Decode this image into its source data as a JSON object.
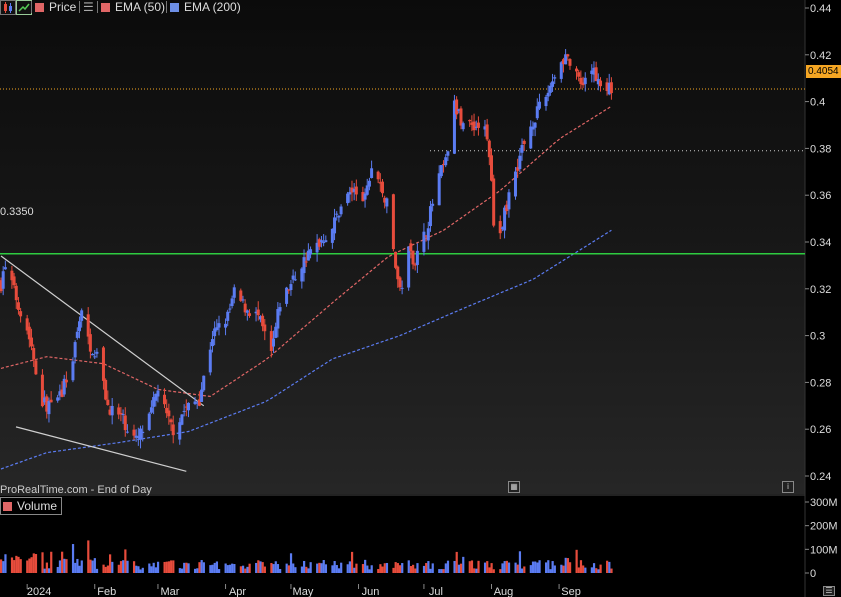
{
  "toolbar": {
    "items": [
      {
        "name": "Price",
        "color": "#e06666"
      },
      {
        "name": "EMA (50)",
        "color": "#e06666"
      },
      {
        "name": "EMA (200)",
        "color": "#6d8fe6"
      }
    ]
  },
  "watermark": "ProRealTime.com - End of Day",
  "volume_legend": "Volume",
  "price_tag": "0.4054",
  "support_label": "0.3350",
  "colors": {
    "up": "#5b7cf2",
    "down": "#e74c3c",
    "support": "#2ecc40",
    "ema50": "#e06666",
    "ema200": "#5b7cf2",
    "price_line": "#f5a623",
    "background": "#000000"
  },
  "chart_data": {
    "type": "candlestick",
    "price_axis": {
      "ticks": [
        "0.44",
        "0.42",
        "0.4",
        "0.38",
        "0.36",
        "0.34",
        "0.32",
        "0.3",
        "0.28",
        "0.26",
        "0.24"
      ],
      "range": [
        0.235,
        0.445
      ]
    },
    "volume_axis": {
      "ticks": [
        "300M",
        "200M",
        "100M",
        "0"
      ],
      "range": [
        0,
        300
      ]
    },
    "x_axis": {
      "labels": [
        "2024",
        "Feb",
        "Mar",
        "Apr",
        "May",
        "Jun",
        "Jul",
        "Aug",
        "Sep"
      ]
    },
    "last_price": 0.4054,
    "support_level": 0.335,
    "resistance_level": 0.379,
    "trendline_upper": [
      {
        "date": "2023-12-20",
        "value": 0.334
      },
      {
        "date": "2024-03-22",
        "value": 0.27
      }
    ],
    "trendline_lower": [
      {
        "date": "2023-12-20",
        "value": 0.261
      },
      {
        "date": "2024-03-14",
        "value": 0.242
      }
    ],
    "close_anchors": [
      {
        "date": "2023-12-20",
        "value": 0.322
      },
      {
        "date": "2023-12-22",
        "value": 0.33
      },
      {
        "date": "2024-01-02",
        "value": 0.3
      },
      {
        "date": "2024-01-08",
        "value": 0.272
      },
      {
        "date": "2024-01-12",
        "value": 0.269
      },
      {
        "date": "2024-01-17",
        "value": 0.276
      },
      {
        "date": "2024-01-22",
        "value": 0.29
      },
      {
        "date": "2024-01-24",
        "value": 0.3
      },
      {
        "date": "2024-01-26",
        "value": 0.312
      },
      {
        "date": "2024-01-30",
        "value": 0.296
      },
      {
        "date": "2024-02-02",
        "value": 0.292
      },
      {
        "date": "2024-02-07",
        "value": 0.27
      },
      {
        "date": "2024-02-13",
        "value": 0.265
      },
      {
        "date": "2024-02-20",
        "value": 0.255
      },
      {
        "date": "2024-02-26",
        "value": 0.264
      },
      {
        "date": "2024-03-01",
        "value": 0.278
      },
      {
        "date": "2024-03-05",
        "value": 0.265
      },
      {
        "date": "2024-03-08",
        "value": 0.26
      },
      {
        "date": "2024-03-13",
        "value": 0.268
      },
      {
        "date": "2024-03-20",
        "value": 0.273
      },
      {
        "date": "2024-03-26",
        "value": 0.3
      },
      {
        "date": "2024-04-02",
        "value": 0.308
      },
      {
        "date": "2024-04-05",
        "value": 0.318
      },
      {
        "date": "2024-04-10",
        "value": 0.312
      },
      {
        "date": "2024-04-16",
        "value": 0.308
      },
      {
        "date": "2024-04-22",
        "value": 0.292
      },
      {
        "date": "2024-04-26",
        "value": 0.314
      },
      {
        "date": "2024-05-01",
        "value": 0.322
      },
      {
        "date": "2024-05-07",
        "value": 0.332
      },
      {
        "date": "2024-05-14",
        "value": 0.34
      },
      {
        "date": "2024-05-20",
        "value": 0.346
      },
      {
        "date": "2024-05-24",
        "value": 0.356
      },
      {
        "date": "2024-05-29",
        "value": 0.362
      },
      {
        "date": "2024-06-04",
        "value": 0.358
      },
      {
        "date": "2024-06-07",
        "value": 0.372
      },
      {
        "date": "2024-06-11",
        "value": 0.364
      },
      {
        "date": "2024-06-14",
        "value": 0.356
      },
      {
        "date": "2024-06-18",
        "value": 0.33
      },
      {
        "date": "2024-06-20",
        "value": 0.318
      },
      {
        "date": "2024-06-24",
        "value": 0.336
      },
      {
        "date": "2024-06-27",
        "value": 0.332
      },
      {
        "date": "2024-07-02",
        "value": 0.345
      },
      {
        "date": "2024-07-08",
        "value": 0.368
      },
      {
        "date": "2024-07-11",
        "value": 0.374
      },
      {
        "date": "2024-07-15",
        "value": 0.398
      },
      {
        "date": "2024-07-18",
        "value": 0.392
      },
      {
        "date": "2024-07-24",
        "value": 0.39
      },
      {
        "date": "2024-07-29",
        "value": 0.388
      },
      {
        "date": "2024-07-31",
        "value": 0.378
      },
      {
        "date": "2024-08-02",
        "value": 0.35
      },
      {
        "date": "2024-08-05",
        "value": 0.344
      },
      {
        "date": "2024-08-09",
        "value": 0.36
      },
      {
        "date": "2024-08-15",
        "value": 0.38
      },
      {
        "date": "2024-08-20",
        "value": 0.392
      },
      {
        "date": "2024-08-26",
        "value": 0.402
      },
      {
        "date": "2024-08-30",
        "value": 0.412
      },
      {
        "date": "2024-09-04",
        "value": 0.42
      },
      {
        "date": "2024-09-09",
        "value": 0.41
      },
      {
        "date": "2024-09-12",
        "value": 0.405
      },
      {
        "date": "2024-09-16",
        "value": 0.414
      },
      {
        "date": "2024-09-20",
        "value": 0.408
      },
      {
        "date": "2024-09-25",
        "value": 0.4054
      }
    ],
    "ema50_anchors": [
      {
        "date": "2023-12-20",
        "value": 0.286
      },
      {
        "date": "2024-01-10",
        "value": 0.291
      },
      {
        "date": "2024-02-05",
        "value": 0.288
      },
      {
        "date": "2024-03-01",
        "value": 0.277
      },
      {
        "date": "2024-03-25",
        "value": 0.274
      },
      {
        "date": "2024-04-20",
        "value": 0.29
      },
      {
        "date": "2024-05-20",
        "value": 0.314
      },
      {
        "date": "2024-06-15",
        "value": 0.334
      },
      {
        "date": "2024-07-10",
        "value": 0.345
      },
      {
        "date": "2024-08-05",
        "value": 0.362
      },
      {
        "date": "2024-09-01",
        "value": 0.384
      },
      {
        "date": "2024-09-25",
        "value": 0.398
      }
    ],
    "ema200_anchors": [
      {
        "date": "2023-12-20",
        "value": 0.243
      },
      {
        "date": "2024-01-10",
        "value": 0.25
      },
      {
        "date": "2024-02-10",
        "value": 0.254
      },
      {
        "date": "2024-03-15",
        "value": 0.259
      },
      {
        "date": "2024-04-20",
        "value": 0.272
      },
      {
        "date": "2024-05-20",
        "value": 0.29
      },
      {
        "date": "2024-06-20",
        "value": 0.3
      },
      {
        "date": "2024-07-20",
        "value": 0.312
      },
      {
        "date": "2024-08-20",
        "value": 0.324
      },
      {
        "date": "2024-09-25",
        "value": 0.345
      }
    ]
  }
}
